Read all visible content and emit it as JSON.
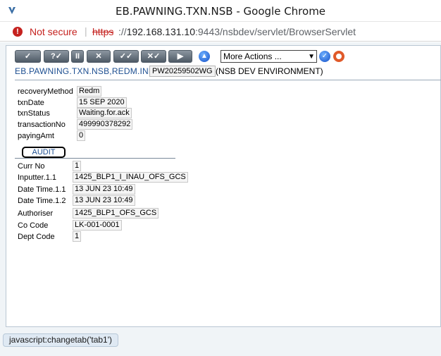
{
  "window": {
    "title": "EB.PAWNING.TXN.NSB - Google Chrome",
    "icon": "app-icon"
  },
  "address_bar": {
    "security_icon": "warning-icon",
    "security_text": "Not secure",
    "separator": "|",
    "scheme": "https",
    "rest_prefix": "://",
    "host": "192.168.131.10",
    "path": ":9443/nsbdev/servlet/BrowserServlet"
  },
  "toolbar": {
    "buttons": [
      "✓",
      "?✓",
      "II",
      "✕",
      "✓✓",
      "✕✓",
      "▶"
    ],
    "more_actions": "More Actions ...",
    "go_icon": "go-icon",
    "help_icon": "lifebuoy-icon",
    "up_icon": "up-arrow-icon"
  },
  "header": {
    "application": "EB.PAWNING.TXN.NSB,REDM.INPUT",
    "record_id": "PW20259502WG",
    "environment": "(NSB DEV ENVIRONMENT)"
  },
  "fields": [
    {
      "label": "recoveryMethod",
      "value": "Redm"
    },
    {
      "label": "txnDate",
      "value": "15 SEP 2020"
    },
    {
      "label": "txnStatus",
      "value": "Waiting.for.ack"
    },
    {
      "label": "transactionNo",
      "value": "499990378292"
    },
    {
      "label": "payingAmt",
      "value": "0"
    }
  ],
  "audit": {
    "tab_label": "AUDIT",
    "fields": [
      {
        "label": "Curr No",
        "value": "1"
      },
      {
        "label": "Inputter.1.1",
        "value": "1425_BLP1_I_INAU_OFS_GCS"
      },
      {
        "label": "Date Time.1.1",
        "value": "13 JUN 23 10:49"
      },
      {
        "label": "Date Time.1.2",
        "value": "13 JUN 23 10:49"
      },
      {
        "label": "Authoriser",
        "value": "1425_BLP1_OFS_GCS"
      },
      {
        "label": "Co Code",
        "value": "LK-001-0001"
      },
      {
        "label": "Dept Code",
        "value": "1"
      }
    ]
  },
  "status_bar": {
    "text": "javascript:changetab('tab1')"
  },
  "colors": {
    "link_blue": "#1d4f91",
    "warning_red": "#c5221f",
    "toolbar_button": "#5c6773"
  }
}
